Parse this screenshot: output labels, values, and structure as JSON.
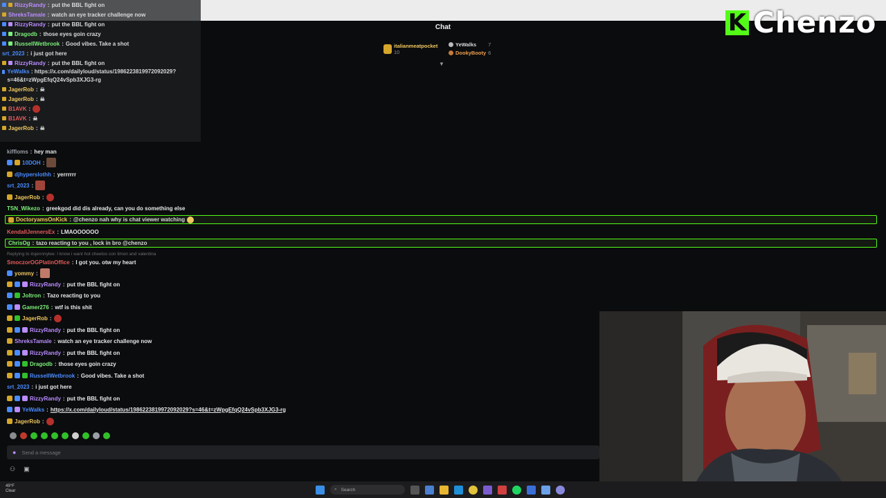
{
  "chat_header": "Chat",
  "leaderboard": {
    "first": {
      "name": "italianmeatpocket",
      "count": "10"
    },
    "second": {
      "name": "YeWalks",
      "count": "7"
    },
    "third": {
      "name": "DookyBooty",
      "count": "6"
    }
  },
  "overlay_log": [
    {
      "user": "RizzyRandy",
      "text": "put the BBL fight on",
      "color": "#b98cff"
    },
    {
      "user": "ShreksTamale",
      "text": "watch an eye tracker challenge now",
      "color": "#b98cff"
    },
    {
      "user": "RizzyRandy",
      "text": "put the BBL fight on",
      "color": "#b98cff"
    },
    {
      "user": "Dragodb",
      "text": "those eyes goin crazy",
      "color": "#7cf07a"
    },
    {
      "user": "RussellWetbrook",
      "text": "Good vibes. Take a shot",
      "color": "#7cf07a"
    },
    {
      "user": "srt_2023",
      "text": "i just got here",
      "color": "#4a8cff"
    },
    {
      "user": "RizzyRandy",
      "text": "put the BBL fight on",
      "color": "#b98cff"
    }
  ],
  "overlay_url": {
    "user": "YeWalks",
    "text": "https://x.com/dailyloud/status/1986223819972092029?s=46&t=zWpgEfqQ24vSpb3XJG3-rg",
    "color": "#4a8cff"
  },
  "overlay_tail": [
    {
      "user": "JagerRob",
      "color": "#f0c860"
    },
    {
      "user": "JagerRob",
      "color": "#f0c860"
    },
    {
      "user": "B1AVK",
      "color": "#e35b5b"
    },
    {
      "user": "B1AVK",
      "color": "#e35b5b"
    },
    {
      "user": "JagerRob",
      "color": "#f0c860"
    }
  ],
  "main_chat": {
    "m1": {
      "user": "kiffloms",
      "text": "hey man",
      "color": "#9aa0a6"
    },
    "m2": {
      "user": "10DOH",
      "color": "#4a8cff"
    },
    "m3": {
      "user": "djhyperslothh",
      "text": "yerrrrrr",
      "color": "#4a8cff"
    },
    "m4": {
      "user": "srt_2023",
      "color": "#4a8cff"
    },
    "m5": {
      "user": "JagerRob",
      "color": "#f0c860"
    },
    "m6": {
      "user": "TSN_Wikezo",
      "text": "greekgod did dis already, can you do something else",
      "color": "#7cf07a"
    },
    "h1": {
      "user": "DoctoryamsOnKick",
      "text": "@chenzo nah why is chat viewer watching",
      "color": "#f0c860"
    },
    "m7": {
      "user": "KendallJennersEx",
      "text": "LMAOOOOOO",
      "color": "#e35b5b"
    },
    "h2": {
      "user": "ChrisOg",
      "text": "tazo reacting to you , lock in bro @chenzo",
      "color": "#7cf07a"
    },
    "reply": "Replying to itsjennnylee: I know i want hot cheetos con limon and valentina",
    "m8": {
      "user": "SmoczorOGPlatinOffice",
      "text": "I got you. otw my heart",
      "color": "#e35b5b"
    },
    "m9": {
      "user": "yommy",
      "color": "#f0c860"
    },
    "m10": {
      "user": "RizzyRandy",
      "text": "put the BBL fight on",
      "color": "#b98cff"
    },
    "m11": {
      "user": "Joltron",
      "text": "Tazo reacting to you",
      "color": "#7cf07a"
    },
    "m12": {
      "user": "Gamer276",
      "text": "wtf is this shit",
      "color": "#7cf07a"
    },
    "m13": {
      "user": "JagerRob",
      "color": "#f0c860"
    },
    "m14": {
      "user": "RizzyRandy",
      "text": "put the BBL fight on",
      "color": "#b98cff"
    },
    "m15": {
      "user": "ShreksTamale",
      "text": "watch an eye tracker challenge now",
      "color": "#b98cff"
    },
    "m16": {
      "user": "RizzyRandy",
      "text": "put the BBL fight on",
      "color": "#b98cff"
    },
    "m17": {
      "user": "Dragodb",
      "text": "those eyes goin crazy",
      "color": "#7cf07a"
    },
    "m18": {
      "user": "RussellWetbrook",
      "text": "Good vibes. Take a shot",
      "color": "#4a8cff"
    },
    "m19": {
      "user": "srt_2023",
      "text": "i just got here",
      "color": "#4a8cff"
    },
    "m20": {
      "user": "RizzyRandy",
      "text": "put the BBL fight on",
      "color": "#b98cff"
    },
    "m21": {
      "user": "YeWalks",
      "text": "https://x.com/dailyloud/status/1986223819972092029?s=46&t=zWpgEfqQ24vSpb3XJG3-rg",
      "color": "#4a8cff"
    },
    "m22": {
      "user": "JagerRob",
      "color": "#f0c860"
    }
  },
  "send_placeholder": "Send a message",
  "logo_text": "Chenzo",
  "logo_mark": "K",
  "taskbar": {
    "search_placeholder": "Search",
    "weather": "49°F",
    "weather_desc": "Clear"
  },
  "colors": {
    "kick_green": "#53fc18",
    "background": "#0b0c0d",
    "input_bg": "#202124"
  }
}
